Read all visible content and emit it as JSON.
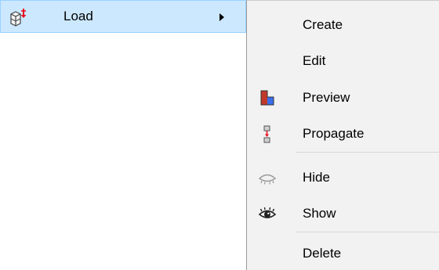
{
  "parent_item": {
    "label": "Load",
    "icon": "load-icon"
  },
  "submenu": {
    "items": [
      {
        "label": "Create",
        "icon": ""
      },
      {
        "label": "Edit",
        "icon": ""
      },
      {
        "label": "Preview",
        "icon": "preview-icon"
      },
      {
        "label": "Propagate",
        "icon": "propagate-icon"
      },
      {
        "label": "Hide",
        "icon": "hide-eye-icon"
      },
      {
        "label": "Show",
        "icon": "show-eye-icon"
      },
      {
        "label": "Delete",
        "icon": ""
      }
    ]
  },
  "colors": {
    "highlight_bg": "#cce8ff",
    "highlight_border": "#99d1ff",
    "menu_bg": "#f2f2f2",
    "accent_red": "#e81123",
    "accent_blue": "#2d5bd6"
  }
}
